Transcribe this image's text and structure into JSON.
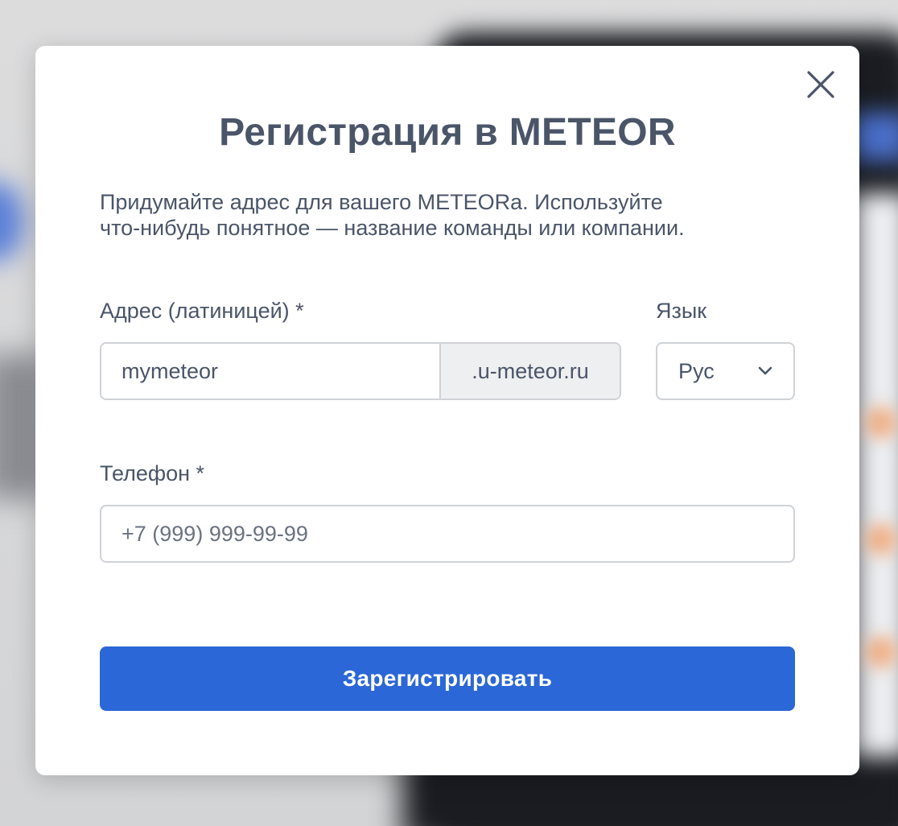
{
  "modal": {
    "title": "Регистрация в METEOR",
    "subtitle_line1": "Придумайте адрес для вашего METEORa. Используйте",
    "subtitle_line2": "что-нибудь понятное — название команды или компании.",
    "close_icon": "close-icon"
  },
  "form": {
    "address": {
      "label": "Адрес (латиницей) *",
      "value": "mymeteor",
      "suffix": ".u-meteor.ru"
    },
    "language": {
      "label": "Язык",
      "selected": "Рус",
      "icon": "chevron-down-icon"
    },
    "phone": {
      "label": "Телефон *",
      "placeholder": "+7 (999) 999-99-99",
      "value": ""
    },
    "submit_label": "Зарегистрировать"
  },
  "colors": {
    "primary": "#2b67d6",
    "text": "#4a5568",
    "border": "#cfd2d6",
    "suffix_bg": "#eeeff1"
  }
}
